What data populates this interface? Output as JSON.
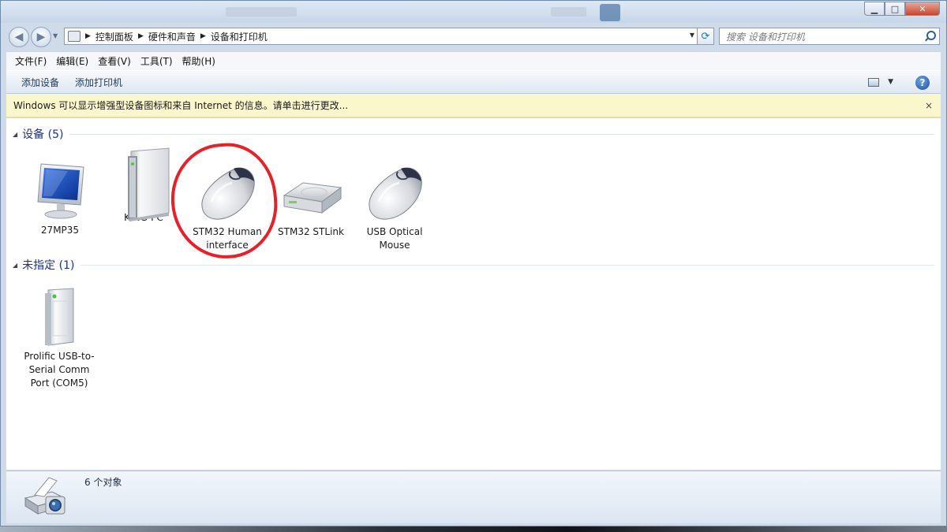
{
  "address": {
    "crumbs": [
      "控制面板",
      "硬件和声音",
      "设备和打印机"
    ],
    "search_placeholder": "搜索 设备和打印机"
  },
  "menu": [
    "文件(F)",
    "编辑(E)",
    "查看(V)",
    "工具(T)",
    "帮助(H)"
  ],
  "commands": {
    "add_device": "添加设备",
    "add_printer": "添加打印机"
  },
  "infobar": {
    "text": "Windows 可以显示增强型设备图标和来自 Internet 的信息。请单击进行更改...",
    "close": "×"
  },
  "groups": {
    "devices": {
      "title": "设备 (5)",
      "items": [
        {
          "label": "27MP35",
          "icon": "monitor-icon"
        },
        {
          "label": "KING-PC",
          "icon": "computer-tower-icon"
        },
        {
          "label": "STM32 Human interface",
          "icon": "mouse-icon"
        },
        {
          "label": "STM32 STLink",
          "icon": "external-drive-icon"
        },
        {
          "label": "USB Optical Mouse",
          "icon": "mouse-icon"
        }
      ]
    },
    "unspecified": {
      "title": "未指定 (1)",
      "items": [
        {
          "label": "Prolific USB-to-Serial Comm Port (COM5)",
          "icon": "generic-device-icon"
        }
      ]
    }
  },
  "details": {
    "count": "6 个对象",
    "icon": "printer-camera-icon"
  },
  "colors": {
    "annotation_ring": "#e8202a",
    "group_title": "#1e3287",
    "infobar_bg": "#fbf7cd"
  }
}
